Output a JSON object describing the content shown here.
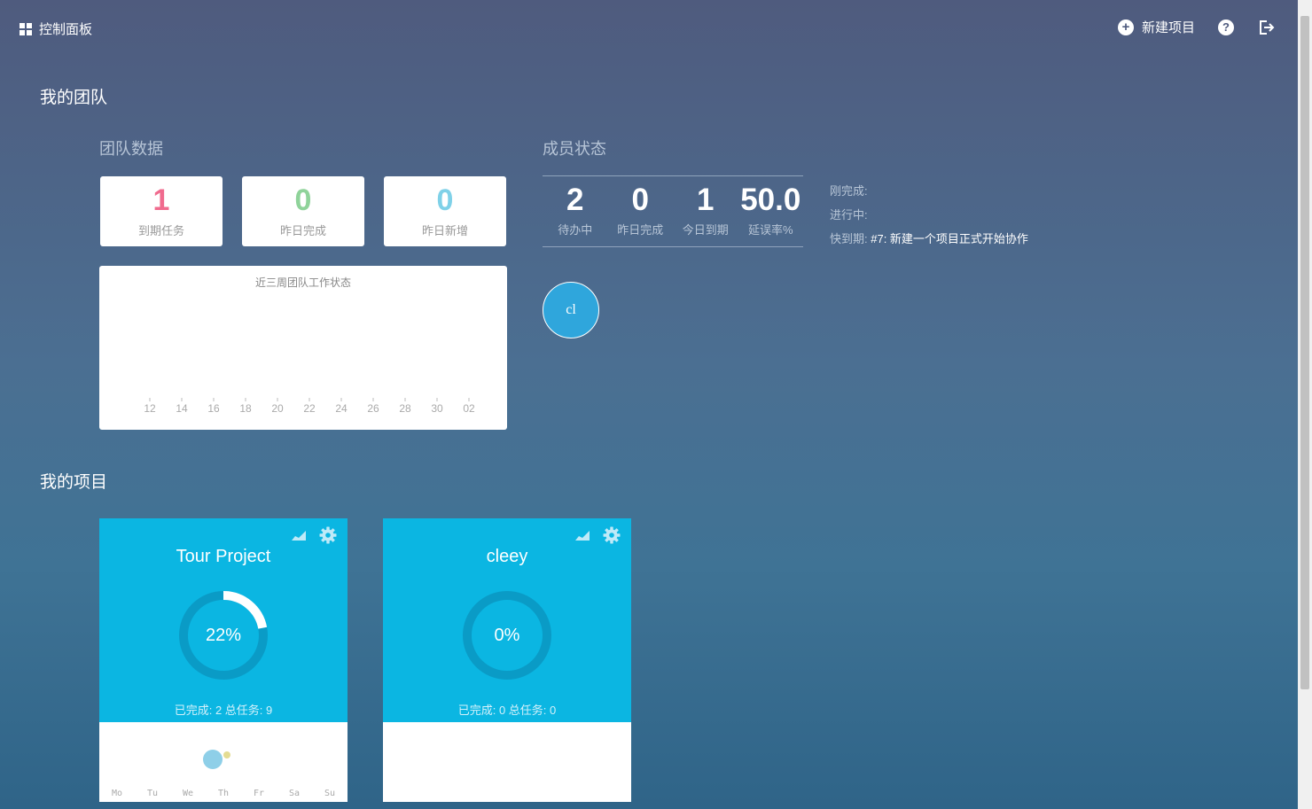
{
  "header": {
    "title": "控制面板",
    "new_project": "新建项目"
  },
  "team": {
    "section_title": "我的团队",
    "data_title": "团队数据",
    "stats": [
      {
        "value": "1",
        "label": "到期任务",
        "color": "#f06b8e"
      },
      {
        "value": "0",
        "label": "昨日完成",
        "color": "#8fd39a"
      },
      {
        "value": "0",
        "label": "昨日新增",
        "color": "#7fd1e8"
      }
    ],
    "chart_title": "近三周团队工作状态",
    "members_title": "成员状态",
    "member_stats": [
      {
        "value": "2",
        "label": "待办中"
      },
      {
        "value": "0",
        "label": "昨日完成"
      },
      {
        "value": "1",
        "label": "今日到期"
      },
      {
        "value": "50.0",
        "label": "延误率%"
      }
    ],
    "status": {
      "just_done_label": "刚完成:",
      "in_progress_label": "进行中:",
      "due_soon_label": "快到期:",
      "due_soon_task": "#7: 新建一个项目正式开始协作"
    },
    "avatar_text": "cl"
  },
  "chart_data": {
    "type": "line",
    "title": "近三周团队工作状态",
    "categories": [
      "12",
      "14",
      "16",
      "18",
      "20",
      "22",
      "24",
      "26",
      "28",
      "30",
      "02"
    ],
    "series": []
  },
  "projects": {
    "section_title": "我的项目",
    "items": [
      {
        "name": "Tour Project",
        "percent": 22,
        "percent_text": "22%",
        "summary": "已完成: 2 总任务: 9",
        "activity": true
      },
      {
        "name": "cleey",
        "percent": 0,
        "percent_text": "0%",
        "summary": "已完成: 0 总任务: 0",
        "activity": false
      }
    ],
    "weekdays": [
      "Mo",
      "Tu",
      "We",
      "Th",
      "Fr",
      "Sa",
      "Su"
    ]
  },
  "icons": {
    "dashboard": "grid-icon",
    "new_project": "plus-circle-icon",
    "help": "question-circle-icon",
    "logout": "logout-icon",
    "chart": "area-chart-icon",
    "settings": "gear-icon"
  }
}
